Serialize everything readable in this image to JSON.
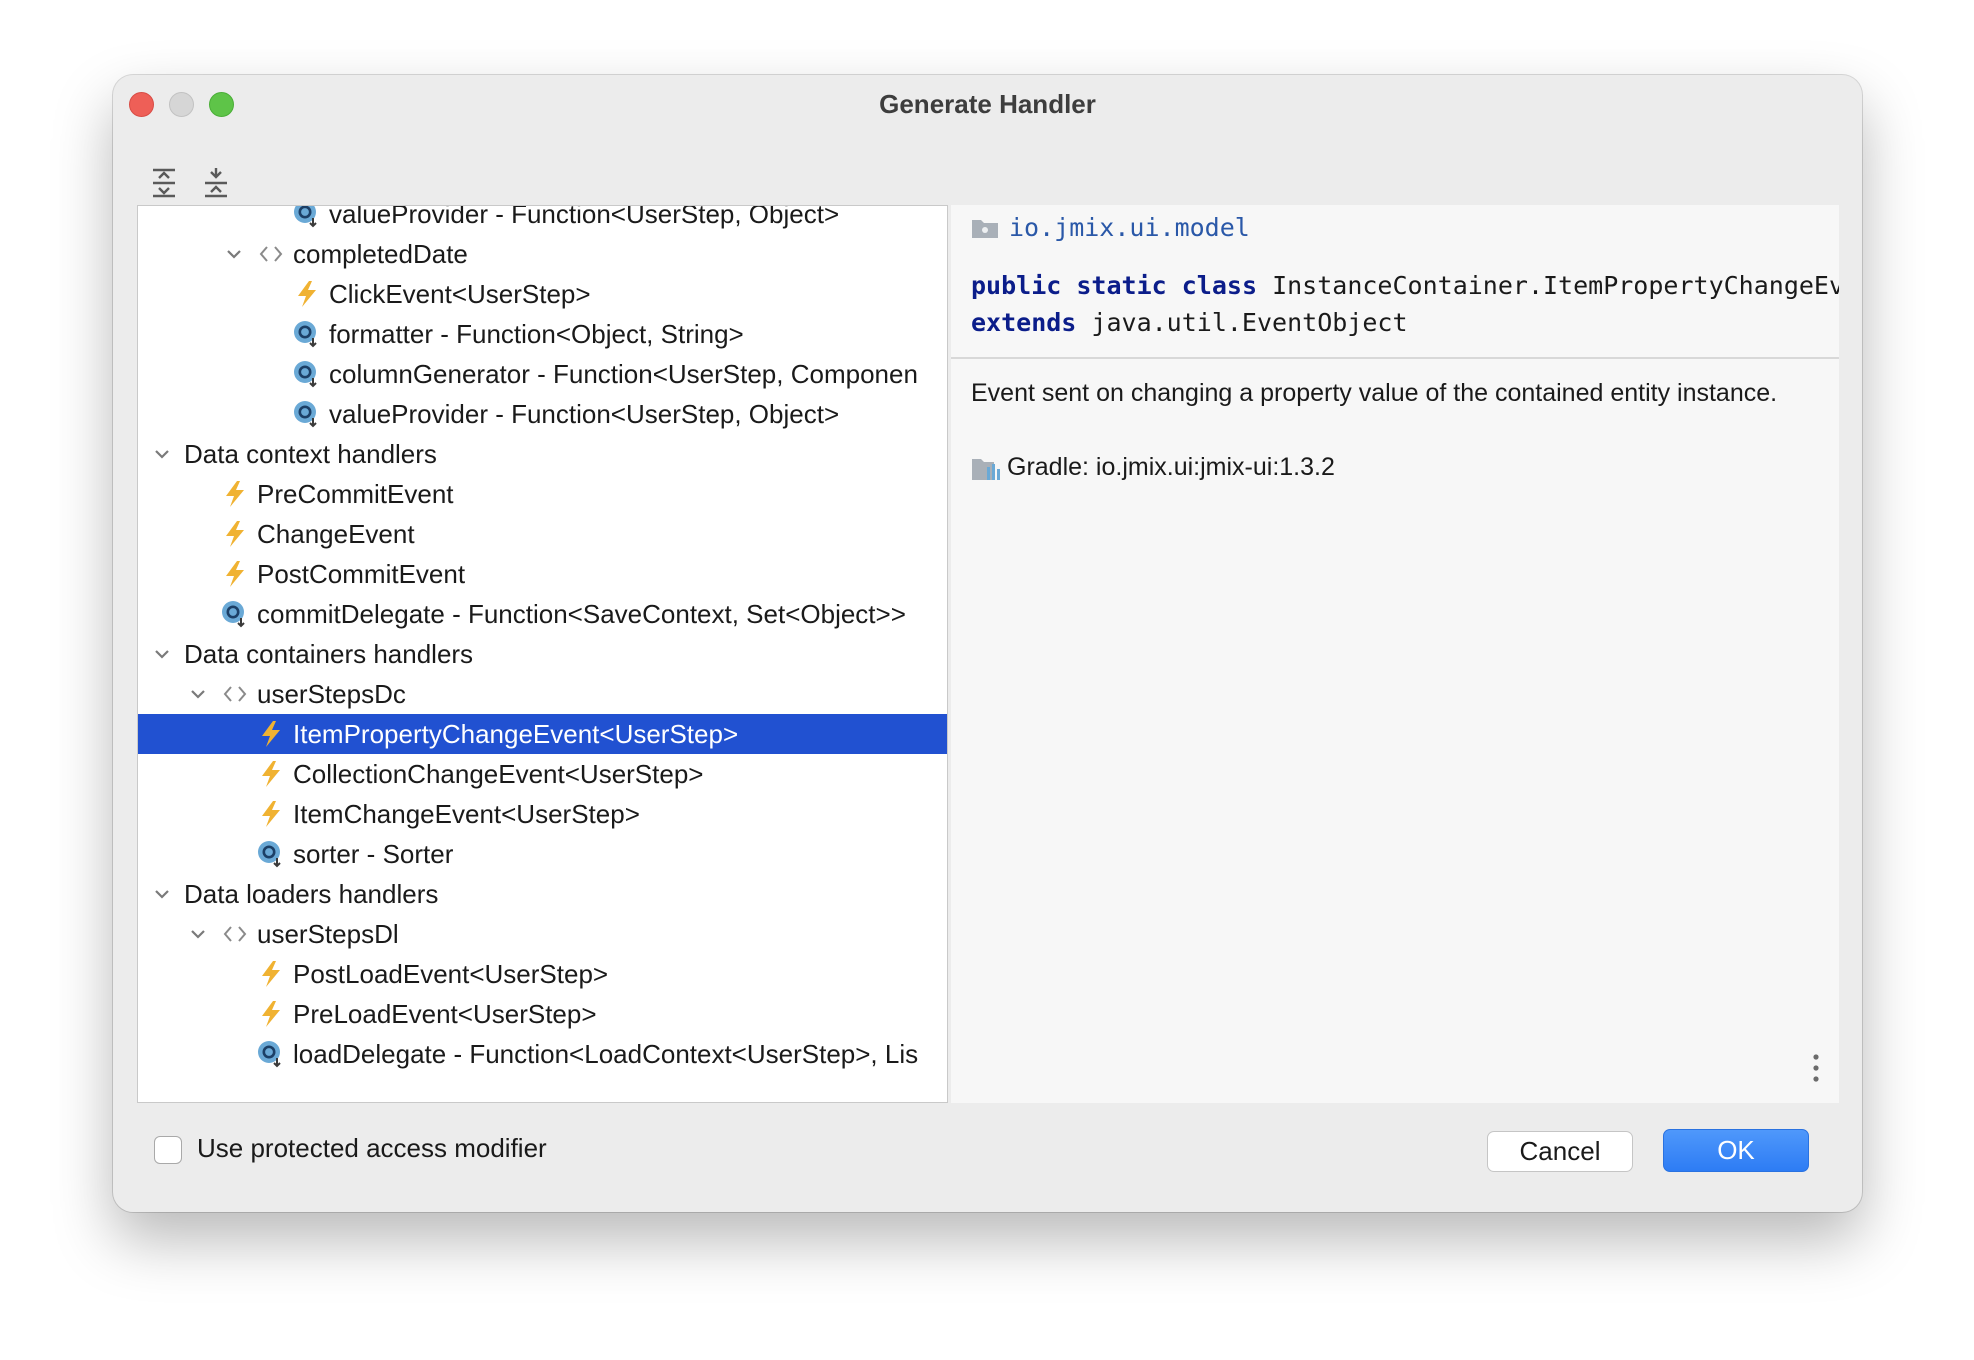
{
  "window": {
    "title": "Generate Handler"
  },
  "toolbar": {
    "expand_all_icon": "expand-all-icon",
    "collapse_all_icon": "collapse-all-icon"
  },
  "tree": {
    "rows": [
      {
        "level": 3,
        "expander": "none",
        "icon": "method",
        "label": "valueProvider - Function<UserStep, Object>"
      },
      {
        "level": 2,
        "expander": "expanded",
        "icon": "component",
        "label": "completedDate"
      },
      {
        "level": 3,
        "expander": "none",
        "icon": "event",
        "label": "ClickEvent<UserStep>"
      },
      {
        "level": 3,
        "expander": "none",
        "icon": "method",
        "label": "formatter - Function<Object, String>"
      },
      {
        "level": 3,
        "expander": "none",
        "icon": "method",
        "label": "columnGenerator - Function<UserStep, Componen"
      },
      {
        "level": 3,
        "expander": "none",
        "icon": "method",
        "label": "valueProvider - Function<UserStep, Object>"
      },
      {
        "level": 0,
        "expander": "expanded",
        "icon": "none",
        "label": "Data context handlers"
      },
      {
        "level": 1,
        "expander": "none",
        "icon": "event",
        "label": "PreCommitEvent"
      },
      {
        "level": 1,
        "expander": "none",
        "icon": "event",
        "label": "ChangeEvent"
      },
      {
        "level": 1,
        "expander": "none",
        "icon": "event",
        "label": "PostCommitEvent"
      },
      {
        "level": 1,
        "expander": "none",
        "icon": "method",
        "label": "commitDelegate - Function<SaveContext, Set<Object>>"
      },
      {
        "level": 0,
        "expander": "expanded",
        "icon": "none",
        "label": "Data containers handlers"
      },
      {
        "level": 1,
        "expander": "expanded",
        "icon": "component",
        "label": "userStepsDc"
      },
      {
        "level": 2,
        "expander": "none",
        "icon": "event",
        "label": "ItemPropertyChangeEvent<UserStep>",
        "selected": true
      },
      {
        "level": 2,
        "expander": "none",
        "icon": "event",
        "label": "CollectionChangeEvent<UserStep>"
      },
      {
        "level": 2,
        "expander": "none",
        "icon": "event",
        "label": "ItemChangeEvent<UserStep>"
      },
      {
        "level": 2,
        "expander": "none",
        "icon": "method",
        "label": "sorter - Sorter"
      },
      {
        "level": 0,
        "expander": "expanded",
        "icon": "none",
        "label": "Data loaders handlers"
      },
      {
        "level": 1,
        "expander": "expanded",
        "icon": "component",
        "label": "userStepsDl"
      },
      {
        "level": 2,
        "expander": "none",
        "icon": "event",
        "label": "PostLoadEvent<UserStep>"
      },
      {
        "level": 2,
        "expander": "none",
        "icon": "event",
        "label": "PreLoadEvent<UserStep>"
      },
      {
        "level": 2,
        "expander": "none",
        "icon": "method",
        "label": "loadDelegate - Function<LoadContext<UserStep>, Lis"
      }
    ]
  },
  "doc": {
    "package": "io.jmix.ui.model",
    "kw_public": "public",
    "kw_static": "static",
    "kw_class": "class",
    "class_name": "InstanceContainer.ItemPropertyChangeEvent",
    "kw_extends": "extends",
    "super_class": "java.util.EventObject",
    "description": "Event sent on changing a property value of the contained entity instance.",
    "gradle": "Gradle: io.jmix.ui:jmix-ui:1.3.2"
  },
  "footer": {
    "checkbox_label": "Use protected access modifier",
    "checkbox_checked": false,
    "cancel_label": "Cancel",
    "ok_label": "OK"
  },
  "colors": {
    "selection": "#2151d1",
    "accent_button": "#2d7cf4",
    "event_icon": "#f0b232",
    "method_icon": "#6aa9d6"
  }
}
